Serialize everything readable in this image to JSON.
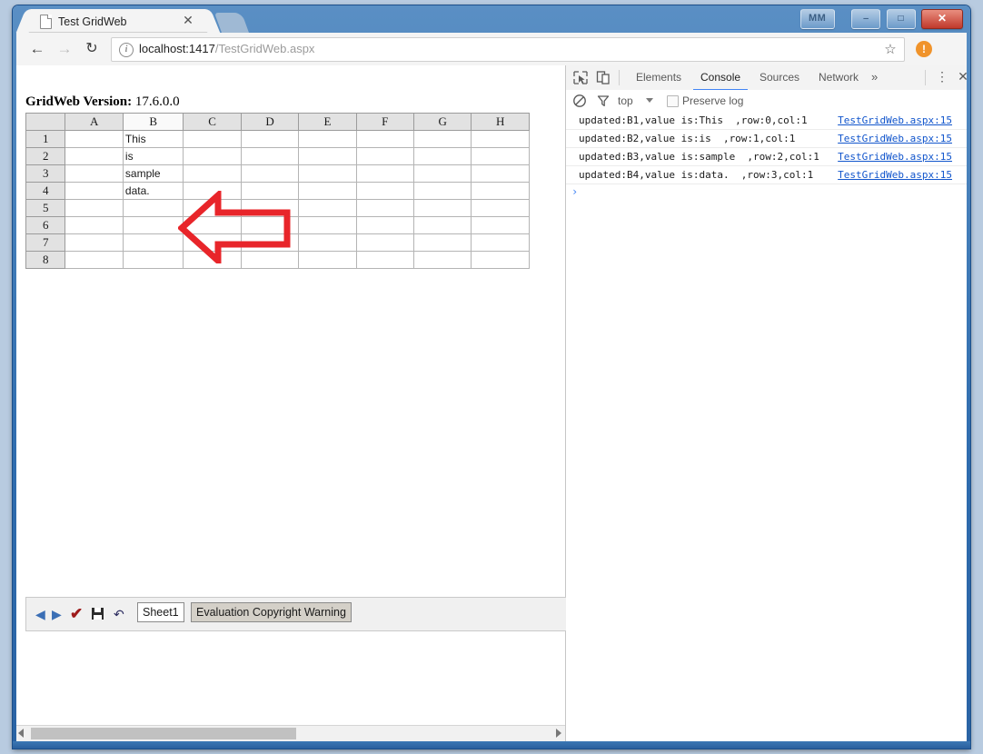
{
  "window": {
    "controls": {
      "extra_label": "MM",
      "minimize_label": "–",
      "maximize_label": "□",
      "close_label": "✕"
    }
  },
  "browser": {
    "tab": {
      "title": "Test GridWeb",
      "close_label": "✕"
    },
    "nav": {
      "back_label": "←",
      "forward_label": "→",
      "reload_label": "↻"
    },
    "omnibox": {
      "info_label": "i",
      "url_host": "localhost:1417",
      "url_path": "/TestGridWeb.aspx",
      "star_label": "☆"
    },
    "update_badge_label": "!"
  },
  "page": {
    "version_label": "GridWeb Version:",
    "version_value": "17.6.0.0",
    "grid": {
      "columns": [
        "A",
        "B",
        "C",
        "D",
        "E",
        "F",
        "G",
        "H"
      ],
      "selected_column": "B",
      "rows": [
        "1",
        "2",
        "3",
        "4",
        "5",
        "6",
        "7",
        "8"
      ],
      "cells": [
        [
          "",
          "This",
          "",
          "",
          "",
          "",
          "",
          ""
        ],
        [
          "",
          "is",
          "",
          "",
          "",
          "",
          "",
          ""
        ],
        [
          "",
          "sample",
          "",
          "",
          "",
          "",
          "",
          ""
        ],
        [
          "",
          "data.",
          "",
          "",
          "",
          "",
          "",
          ""
        ],
        [
          "",
          "",
          "",
          "",
          "",
          "",
          "",
          ""
        ],
        [
          "",
          "",
          "",
          "",
          "",
          "",
          "",
          ""
        ],
        [
          "",
          "",
          "",
          "",
          "",
          "",
          "",
          ""
        ],
        [
          "",
          "",
          "",
          "",
          "",
          "",
          "",
          ""
        ]
      ]
    },
    "toolbar": {
      "prev_label": "◀",
      "next_label": "▶",
      "submit_label": "✔",
      "save_label": "save",
      "undo_label": "↶",
      "sheet_label": "Sheet1",
      "warning_label": "Evaluation Copyright Warning"
    },
    "hscroll": {
      "left_label": "",
      "right_label": ""
    }
  },
  "devtools": {
    "inspect_icon_label": "inspect",
    "device_icon_label": "device",
    "tabs": [
      {
        "label": "Elements",
        "active": false
      },
      {
        "label": "Console",
        "active": true
      },
      {
        "label": "Sources",
        "active": false
      },
      {
        "label": "Network",
        "active": false
      }
    ],
    "more_tabs_label": "»",
    "kebab_label": "⋮",
    "close_label": "✕",
    "filterbar": {
      "clear_label": "clear-console",
      "filter_label": "filter",
      "context_label": "top",
      "preserve_log_label": "Preserve log",
      "preserve_log_checked": false
    },
    "console_messages": [
      {
        "text": "updated:B1,value is:This  ,row:0,col:1",
        "source": "TestGridWeb.aspx:15"
      },
      {
        "text": "updated:B2,value is:is  ,row:1,col:1",
        "source": "TestGridWeb.aspx:15"
      },
      {
        "text": "updated:B3,value is:sample  ,row:2,col:1",
        "source": "TestGridWeb.aspx:15"
      },
      {
        "text": "updated:B4,value is:data.  ,row:3,col:1",
        "source": "TestGridWeb.aspx:15"
      }
    ],
    "prompt_symbol": "›"
  },
  "annotations": {
    "arrow_color": "#e8252a",
    "left_arrow_name": "points-at-column-b-data",
    "up_arrow_name": "points-at-console-output"
  }
}
